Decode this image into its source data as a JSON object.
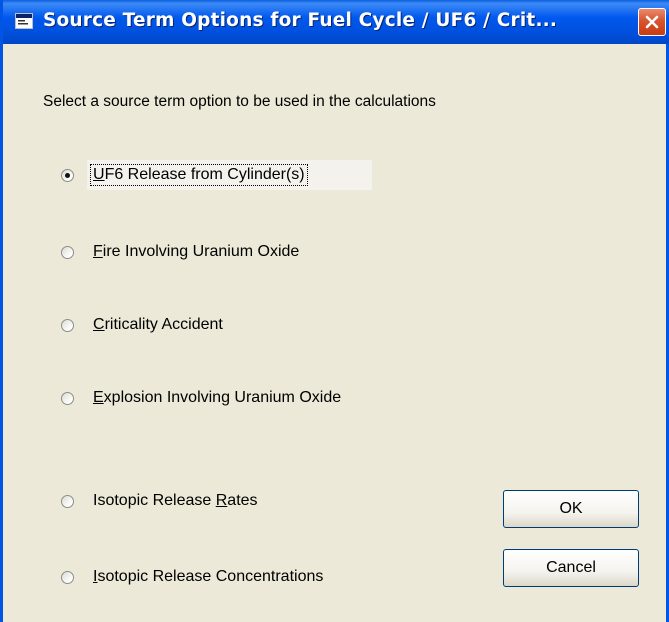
{
  "window": {
    "title": "Source Term Options for Fuel Cycle / UF6 / Crit...",
    "app_icon": "window-app-icon",
    "close_icon": "close-icon"
  },
  "prompt": "Select a source term option to be used in the calculations",
  "options": [
    {
      "pre": "",
      "key": "U",
      "post": "F6 Release from Cylinder(s)",
      "checked": true
    },
    {
      "pre": "",
      "key": "F",
      "post": "ire Involving Uranium Oxide",
      "checked": false
    },
    {
      "pre": "",
      "key": "C",
      "post": "riticality Accident",
      "checked": false
    },
    {
      "pre": "",
      "key": "E",
      "post": "xplosion Involving Uranium Oxide",
      "checked": false
    },
    {
      "pre": "Isotopic Release ",
      "key": "R",
      "post": "ates",
      "checked": false
    },
    {
      "pre": "",
      "key": "I",
      "post": "sotopic Release Concentrations",
      "checked": false
    }
  ],
  "buttons": {
    "ok": "OK",
    "cancel": "Cancel"
  },
  "colors": {
    "titlebar": "#0058ee",
    "dialog_bg": "#ece9d8",
    "close_button": "#d8542f"
  }
}
